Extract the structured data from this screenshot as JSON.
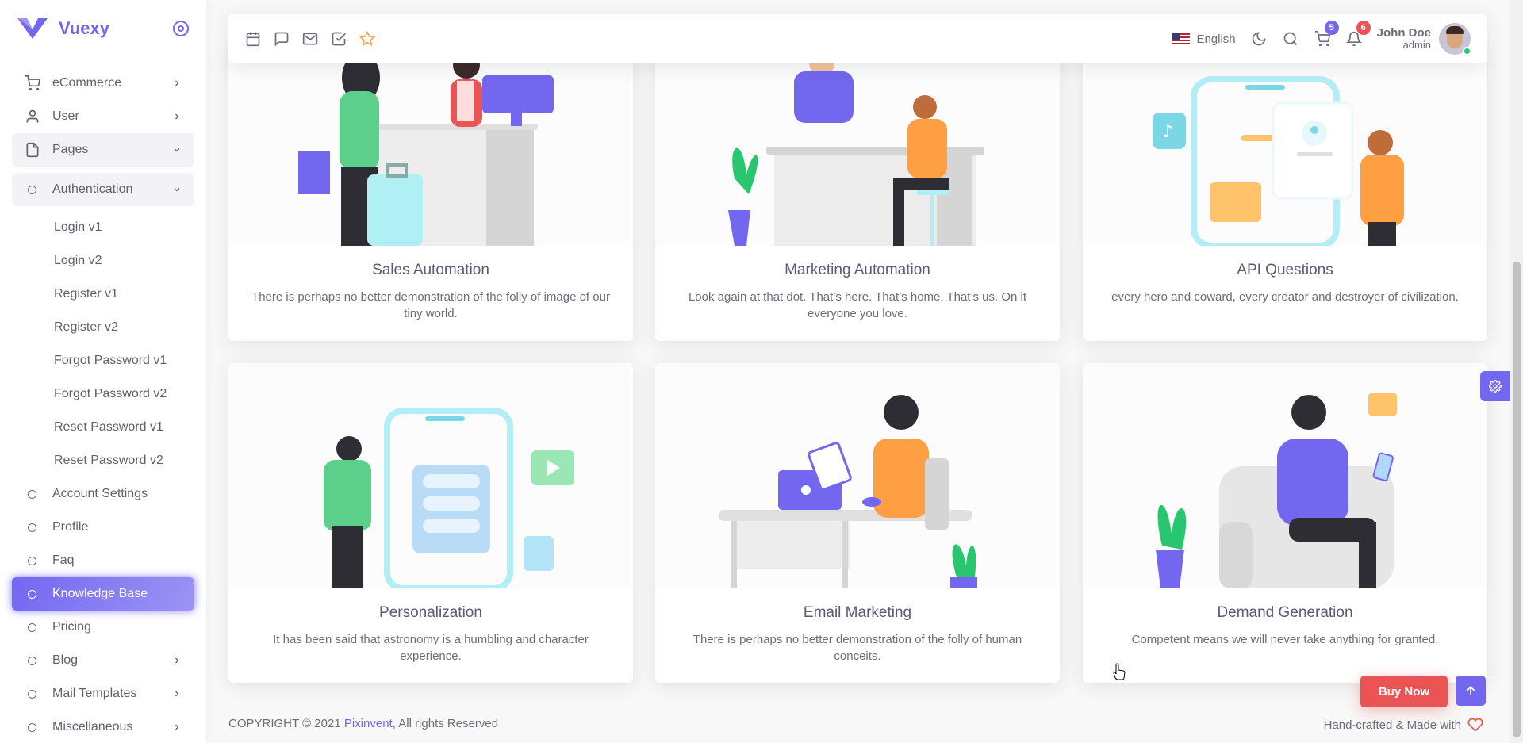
{
  "brand": {
    "name": "Vuexy"
  },
  "sidebar": {
    "items": [
      {
        "label": "eCommerce",
        "icon": "cart-icon"
      },
      {
        "label": "User",
        "icon": "user-icon"
      },
      {
        "label": "Pages",
        "icon": "file-icon"
      },
      {
        "label": "Authentication"
      },
      {
        "label": "Login v1"
      },
      {
        "label": "Login v2"
      },
      {
        "label": "Register v1"
      },
      {
        "label": "Register v2"
      },
      {
        "label": "Forgot Password v1"
      },
      {
        "label": "Forgot Password v2"
      },
      {
        "label": "Reset Password v1"
      },
      {
        "label": "Reset Password v2"
      },
      {
        "label": "Account Settings"
      },
      {
        "label": "Profile"
      },
      {
        "label": "Faq"
      },
      {
        "label": "Knowledge Base"
      },
      {
        "label": "Pricing"
      },
      {
        "label": "Blog"
      },
      {
        "label": "Mail Templates"
      },
      {
        "label": "Miscellaneous"
      }
    ]
  },
  "header": {
    "language": "English",
    "cart_count": "5",
    "notification_count": "6",
    "user_name": "John Doe",
    "user_role": "admin"
  },
  "cards": [
    {
      "title": "Sales Automation",
      "text": "There is perhaps no better demonstration of the folly of image of our tiny world."
    },
    {
      "title": "Marketing Automation",
      "text": "Look again at that dot. That’s here. That’s home. That’s us. On it everyone you love."
    },
    {
      "title": "API Questions",
      "text": "every hero and coward, every creator and destroyer of civilization."
    },
    {
      "title": "Personalization",
      "text": "It has been said that astronomy is a humbling and character experience."
    },
    {
      "title": "Email Marketing",
      "text": "There is perhaps no better demonstration of the folly of human conceits."
    },
    {
      "title": "Demand Generation",
      "text": "Competent means we will never take anything for granted."
    }
  ],
  "footer": {
    "copyright": "COPYRIGHT © 2021",
    "company": "Pixinvent",
    "rights": ", All rights Reserved",
    "made_with": "Hand-crafted & Made with"
  },
  "buttons": {
    "buy_now": "Buy Now"
  },
  "colors": {
    "primary": "#7367f0",
    "danger": "#ea5455",
    "success": "#28c76f"
  }
}
